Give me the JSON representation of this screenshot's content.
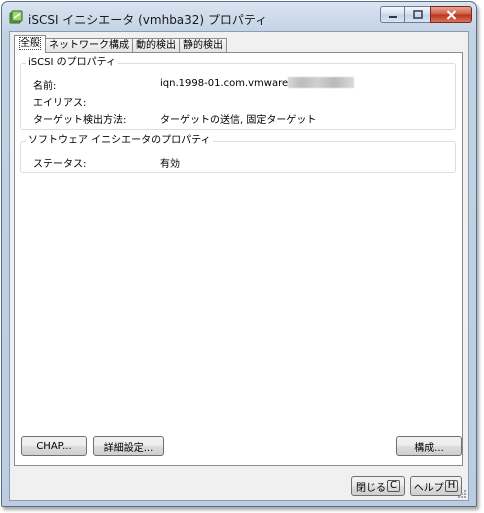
{
  "window": {
    "title": "iSCSI イニシエータ (vmhba32) プロパティ",
    "icon": "iscsi-adapter-icon"
  },
  "titlebar_buttons": {
    "minimize_icon": "minimize-icon",
    "maximize_icon": "maximize-icon",
    "close_icon": "close-icon"
  },
  "tabs": [
    {
      "label": "全般",
      "active": true
    },
    {
      "label": "ネットワーク構成",
      "active": false
    },
    {
      "label": "動的検出",
      "active": false
    },
    {
      "label": "静的検出",
      "active": false
    }
  ],
  "iscsi_properties": {
    "legend": "iSCSI のプロパティ",
    "name_label": "名前:",
    "name_value": "iqn.1998-01.com.vmware",
    "alias_label": "エイリアス:",
    "alias_value": "",
    "discovery_label": "ターゲット検出方法:",
    "discovery_value": "ターゲットの送信, 固定ターゲット"
  },
  "software_initiator_properties": {
    "legend": "ソフトウェア イニシエータのプロパティ",
    "status_label": "ステータス:",
    "status_value": "有効"
  },
  "panel_buttons": {
    "chap_label": "CHAP...",
    "advanced_label": "詳細設定...",
    "configure_label": "構成..."
  },
  "dialog_buttons": {
    "close_label": "閉じる",
    "close_key": "C",
    "help_label": "ヘルプ",
    "help_key": "H"
  },
  "colors": {
    "titlebar": "#c3d3e6",
    "close_button": "#c9432a",
    "group_border": "#d5dfe5"
  }
}
